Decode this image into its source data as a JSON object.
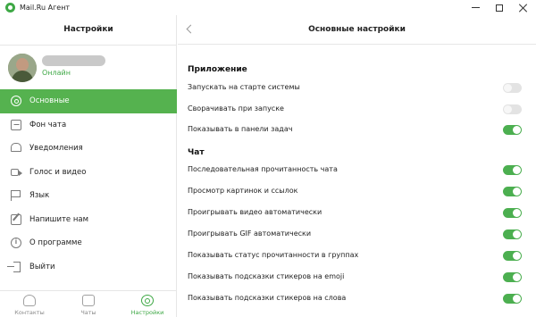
{
  "window": {
    "title": "Mail.Ru Агент"
  },
  "sidebar": {
    "title": "Настройки",
    "profile": {
      "status": "Онлайн"
    },
    "items": [
      {
        "label": "Основные",
        "icon": "gear-icon",
        "active": true
      },
      {
        "label": "Фон чата",
        "icon": "image-icon",
        "active": false
      },
      {
        "label": "Уведомления",
        "icon": "bell-icon",
        "active": false
      },
      {
        "label": "Голос и видео",
        "icon": "video-icon",
        "active": false
      },
      {
        "label": "Язык",
        "icon": "flag-icon",
        "active": false
      },
      {
        "label": "Напишите нам",
        "icon": "edit-icon",
        "active": false
      },
      {
        "label": "О программе",
        "icon": "info-icon",
        "active": false
      },
      {
        "label": "Выйти",
        "icon": "exit-icon",
        "active": false
      }
    ],
    "tabs": [
      {
        "label": "Контакты",
        "icon": "contacts-icon",
        "active": false
      },
      {
        "label": "Чаты",
        "icon": "chat-icon",
        "active": false
      },
      {
        "label": "Настройки",
        "icon": "settings-icon",
        "active": true
      }
    ]
  },
  "main": {
    "title": "Основные настройки",
    "sections": [
      {
        "title": "Приложение",
        "rows": [
          {
            "label": "Запускать на старте системы",
            "enabled": false
          },
          {
            "label": "Сворачивать при запуске",
            "enabled": false
          },
          {
            "label": "Показывать в панели задач",
            "enabled": true
          }
        ]
      },
      {
        "title": "Чат",
        "rows": [
          {
            "label": "Последовательная прочитанность чата",
            "enabled": true
          },
          {
            "label": "Просмотр картинок и ссылок",
            "enabled": true
          },
          {
            "label": "Проигрывать видео автоматически",
            "enabled": true
          },
          {
            "label": "Проигрывать GIF автоматически",
            "enabled": true
          },
          {
            "label": "Показывать статус прочитанности в группах",
            "enabled": true
          },
          {
            "label": "Показывать подсказки стикеров на emoji",
            "enabled": true
          },
          {
            "label": "Показывать подсказки стикеров на слова",
            "enabled": true
          }
        ]
      }
    ]
  },
  "colors": {
    "accent": "#55b24f",
    "toggle_on": "#4caf50",
    "toggle_off": "#e3e3e3",
    "online": "#3ea845"
  }
}
